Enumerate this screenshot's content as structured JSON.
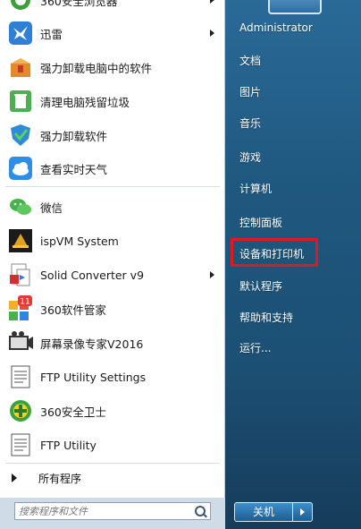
{
  "programs": [
    {
      "label": "360安全浏览器",
      "icon": "360-browser-icon",
      "has_arrow": true
    },
    {
      "label": "迅雷",
      "icon": "xunlei-icon",
      "has_arrow": true
    },
    {
      "label": "强力卸载电脑中的软件",
      "icon": "uninstaller-box-icon",
      "has_arrow": false
    },
    {
      "label": "清理电脑残留垃圾",
      "icon": "recycle-bin-icon",
      "has_arrow": false
    },
    {
      "label": "强力卸载软件",
      "icon": "shield-uninstall-icon",
      "has_arrow": false
    },
    {
      "label": "查看实时天气",
      "icon": "weather-cloud-icon",
      "has_arrow": false
    },
    {
      "label": "微信",
      "icon": "wechat-icon",
      "has_arrow": false
    },
    {
      "label": "ispVM System",
      "icon": "ispvm-icon",
      "has_arrow": false
    },
    {
      "label": "Solid Converter v9",
      "icon": "solid-converter-icon",
      "has_arrow": true
    },
    {
      "label": "360软件管家",
      "icon": "360-software-manager-icon",
      "badge": "11",
      "has_arrow": false
    },
    {
      "label": "屏幕录像专家V2016",
      "icon": "screen-recorder-icon",
      "has_arrow": false
    },
    {
      "label": "FTP Utility Settings",
      "icon": "ftp-settings-icon",
      "has_arrow": false
    },
    {
      "label": "360安全卫士",
      "icon": "360-security-guard-icon",
      "has_arrow": false
    },
    {
      "label": "FTP Utility",
      "icon": "ftp-utility-icon",
      "has_arrow": false
    }
  ],
  "all_programs_label": "所有程序",
  "search": {
    "placeholder": "搜索程序和文件"
  },
  "right_items": [
    {
      "label": "Administrator"
    },
    {
      "label": "文档"
    },
    {
      "label": "图片"
    },
    {
      "label": "音乐"
    },
    {
      "label": "游戏"
    },
    {
      "label": "计算机"
    },
    {
      "label": "控制面板"
    },
    {
      "label": "设备和打印机",
      "highlighted": true
    },
    {
      "label": "默认程序"
    },
    {
      "label": "帮助和支持"
    },
    {
      "label": "运行..."
    }
  ],
  "shutdown_label": "关机",
  "colors": {
    "highlight": "#e3171e",
    "panel": "#1f587f"
  }
}
